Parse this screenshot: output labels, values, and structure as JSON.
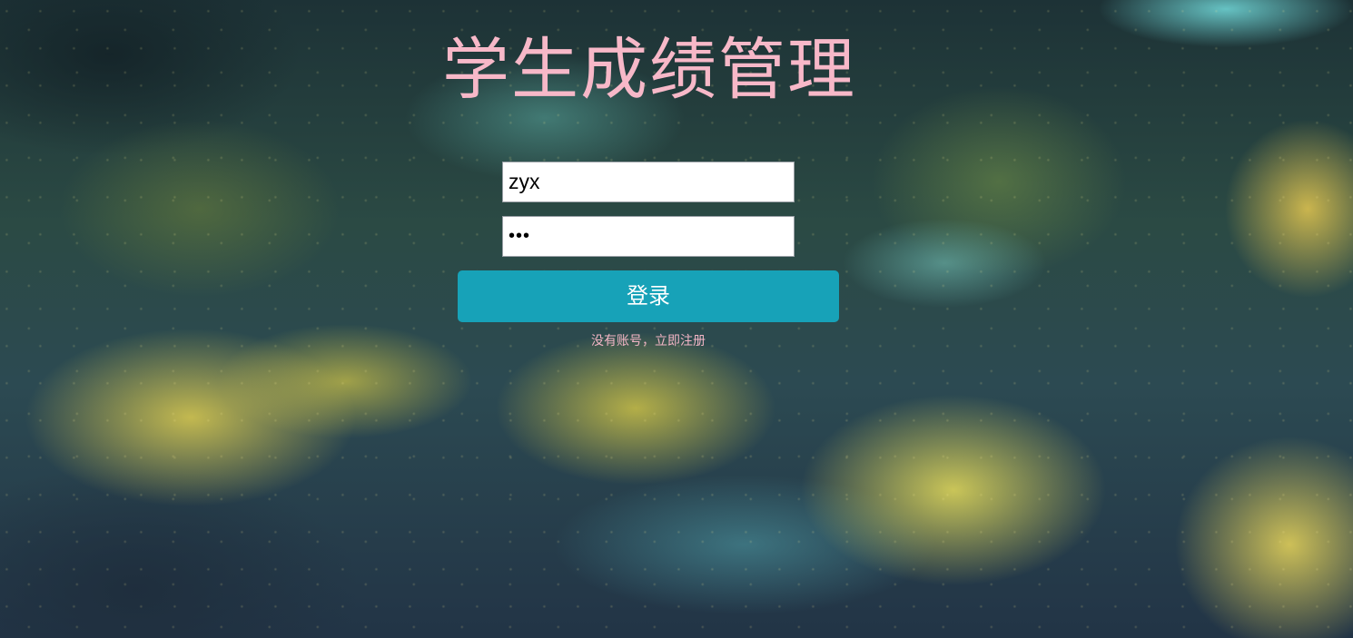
{
  "page": {
    "title": "学生成绩管理"
  },
  "form": {
    "username_value": "zyx",
    "password_value": "abc",
    "login_label": "登录",
    "register_link": "没有账号，立即注册"
  },
  "colors": {
    "title": "#f7b8c8",
    "button_bg": "#17a2b8",
    "button_text": "#ffffff",
    "link": "#f4b6c6"
  }
}
